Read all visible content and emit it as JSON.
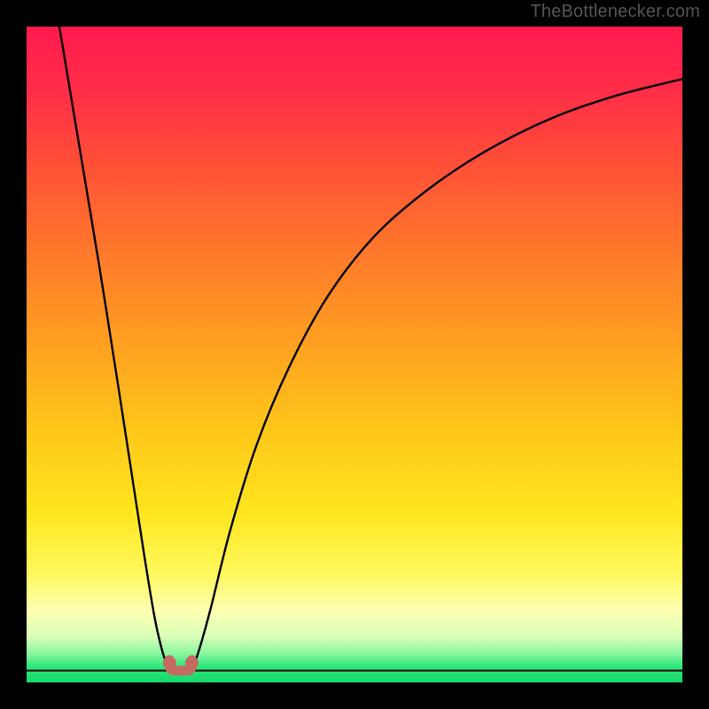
{
  "watermark": "TheBottlenecker.com",
  "gradient_stops": [
    {
      "offset": 0.0,
      "color": "#ff1a4d"
    },
    {
      "offset": 0.1,
      "color": "#ff2e47"
    },
    {
      "offset": 0.22,
      "color": "#ff5336"
    },
    {
      "offset": 0.35,
      "color": "#ff7a2a"
    },
    {
      "offset": 0.5,
      "color": "#ffa51f"
    },
    {
      "offset": 0.62,
      "color": "#ffc81a"
    },
    {
      "offset": 0.74,
      "color": "#ffe51e"
    },
    {
      "offset": 0.83,
      "color": "#fff85a"
    },
    {
      "offset": 0.89,
      "color": "#fdffb0"
    },
    {
      "offset": 0.93,
      "color": "#d9ffb8"
    },
    {
      "offset": 0.955,
      "color": "#8ef7a0"
    },
    {
      "offset": 0.975,
      "color": "#30e87c"
    },
    {
      "offset": 1.0,
      "color": "#17d96b"
    }
  ],
  "chart_data": {
    "type": "line",
    "title": "",
    "xlabel": "",
    "ylabel": "",
    "xlim": [
      0,
      1
    ],
    "ylim": [
      0,
      1
    ],
    "grid": false,
    "annotations": [
      "TheBottlenecker.com"
    ],
    "series": [
      {
        "name": "left-branch",
        "x": [
          0.05,
          0.08,
          0.11,
          0.14,
          0.16,
          0.18,
          0.195,
          0.205,
          0.213,
          0.22
        ],
        "y": [
          1.0,
          0.82,
          0.64,
          0.45,
          0.32,
          0.19,
          0.1,
          0.055,
          0.03,
          0.02
        ]
      },
      {
        "name": "right-branch",
        "x": [
          0.25,
          0.26,
          0.28,
          0.31,
          0.35,
          0.4,
          0.46,
          0.53,
          0.61,
          0.7,
          0.8,
          0.9,
          1.0
        ],
        "y": [
          0.02,
          0.04,
          0.11,
          0.23,
          0.36,
          0.48,
          0.59,
          0.68,
          0.75,
          0.81,
          0.86,
          0.895,
          0.92
        ]
      }
    ],
    "floor_line": {
      "y": 0.018,
      "x_range": [
        0.0,
        1.0
      ]
    },
    "markers": [
      {
        "x": 0.218,
        "y": 0.03
      },
      {
        "x": 0.252,
        "y": 0.03
      }
    ],
    "valley_segment": {
      "x_from": 0.218,
      "x_to": 0.252,
      "y": 0.022
    }
  }
}
